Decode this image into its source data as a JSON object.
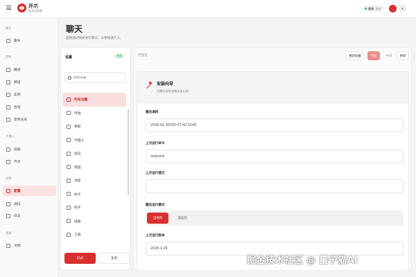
{
  "brand": {
    "name": "开爪",
    "subtitle": "网关运营面"
  },
  "status": {
    "health_label": "健康",
    "health_value": "良好"
  },
  "nav": {
    "sections": [
      {
        "label": "聊天",
        "items": [
          {
            "label": "聊天",
            "icon": "chat-icon"
          }
        ]
      },
      {
        "label": "控制",
        "items": [
          {
            "label": "概述",
            "icon": "chart-icon"
          },
          {
            "label": "频道",
            "icon": "link-icon"
          },
          {
            "label": "实例",
            "icon": "radio-icon"
          },
          {
            "label": "会话",
            "icon": "file-icon"
          },
          {
            "label": "定时任务",
            "icon": "clock-icon"
          }
        ]
      },
      {
        "label": "代理人",
        "items": [
          {
            "label": "技能",
            "icon": "bolt-icon"
          },
          {
            "label": "节点",
            "icon": "monitor-icon"
          }
        ]
      },
      {
        "label": "设置",
        "items": [
          {
            "label": "配置",
            "icon": "gear-icon",
            "active": true
          },
          {
            "label": "调试",
            "icon": "bug-icon"
          },
          {
            "label": "日志",
            "icon": "file-icon"
          }
        ]
      },
      {
        "label": "资源",
        "items": [
          {
            "label": "文档",
            "icon": "book-icon"
          }
        ]
      }
    ]
  },
  "page": {
    "title": "聊天",
    "subtitle": "直接通过网关进行聊天，以便快速介入。"
  },
  "settings": {
    "title": "设置",
    "badge": "有效",
    "search_placeholder": "搜索设置...",
    "categories": [
      {
        "label": "所有设置",
        "icon": "grid-icon",
        "active": true
      },
      {
        "label": "环境",
        "icon": "gear-icon"
      },
      {
        "label": "更新",
        "icon": "download-icon"
      },
      {
        "label": "代理人",
        "icon": "user-icon"
      },
      {
        "label": "验证",
        "icon": "key-icon"
      },
      {
        "label": "频道",
        "icon": "chat-icon"
      },
      {
        "label": "消息",
        "icon": "mail-icon"
      },
      {
        "label": "命令",
        "icon": "terminal-icon"
      },
      {
        "label": "钩子",
        "icon": "link-icon"
      },
      {
        "label": "技能",
        "icon": "star-icon"
      },
      {
        "label": "工具",
        "icon": "wrench-icon"
      }
    ],
    "save_label": "形式",
    "apply_label": "生的"
  },
  "toolbar": {
    "status": "无变化",
    "buttons": [
      "重新加载",
      "节省",
      "申请",
      "更新"
    ]
  },
  "wizard": {
    "title": "安装向导",
    "subtitle": "设置向导状态和历史记录",
    "fields": [
      {
        "label": "最后调用",
        "value": "2026-01-30T05:37:42.524Z"
      },
      {
        "label": "上次运行命令",
        "value": "onboard"
      },
      {
        "label": "上次运行提交",
        "value": ""
      }
    ],
    "mode": {
      "label": "最后运行模式",
      "options": [
        "当地的",
        "遥远的"
      ],
      "selected": "当地的"
    },
    "version": {
      "label": "上次运行版本",
      "value": "2026.1.29"
    }
  },
  "colors": {
    "accent": "#d7302f",
    "accent_soft": "#fbe1e1",
    "success": "#2fb35a"
  },
  "watermark": "掘金技术社区 @ 量子猫AI"
}
